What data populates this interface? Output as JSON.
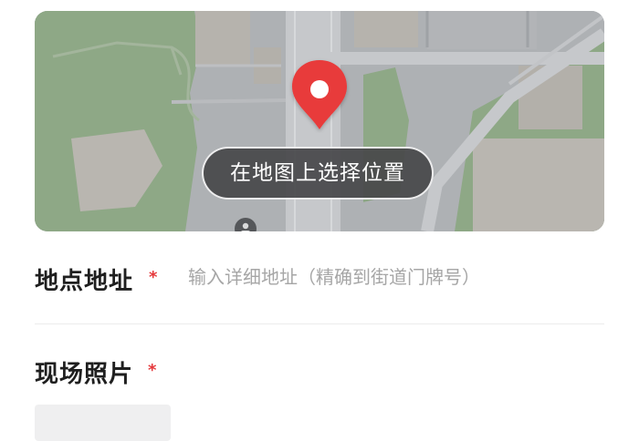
{
  "map": {
    "pick_location_label": "在地图上选择位置",
    "pin_icon": "map-pin-icon",
    "poi_icon": "poi-marker-icon"
  },
  "address_field": {
    "label": "地点地址",
    "required_mark": "*",
    "value": "",
    "placeholder": "输入详细地址（精确到街道门牌号）"
  },
  "photo_field": {
    "label": "现场照片",
    "required_mark": "*"
  },
  "colors": {
    "accent_red": "#e5383b",
    "map_road": "#c9cbce",
    "map_park": "#8ea886",
    "overlay_button": "#48484a"
  }
}
